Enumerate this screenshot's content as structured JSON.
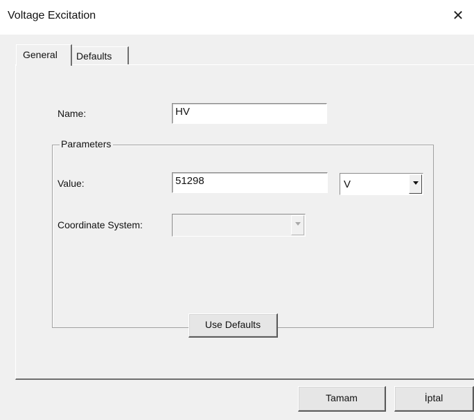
{
  "window": {
    "title": "Voltage Excitation",
    "close_glyph": "✕"
  },
  "tabs": [
    {
      "label": "General",
      "active": true
    },
    {
      "label": "Defaults",
      "active": false
    }
  ],
  "form": {
    "name_label": "Name:",
    "name_value": "HV",
    "group_title": "Parameters",
    "value_label": "Value:",
    "value_value": "51298",
    "unit_selected": "V",
    "coord_label": "Coordinate System:",
    "coord_selected": "",
    "use_defaults_label": "Use Defaults"
  },
  "footer": {
    "ok_label": "Tamam",
    "cancel_label": "İptal"
  }
}
